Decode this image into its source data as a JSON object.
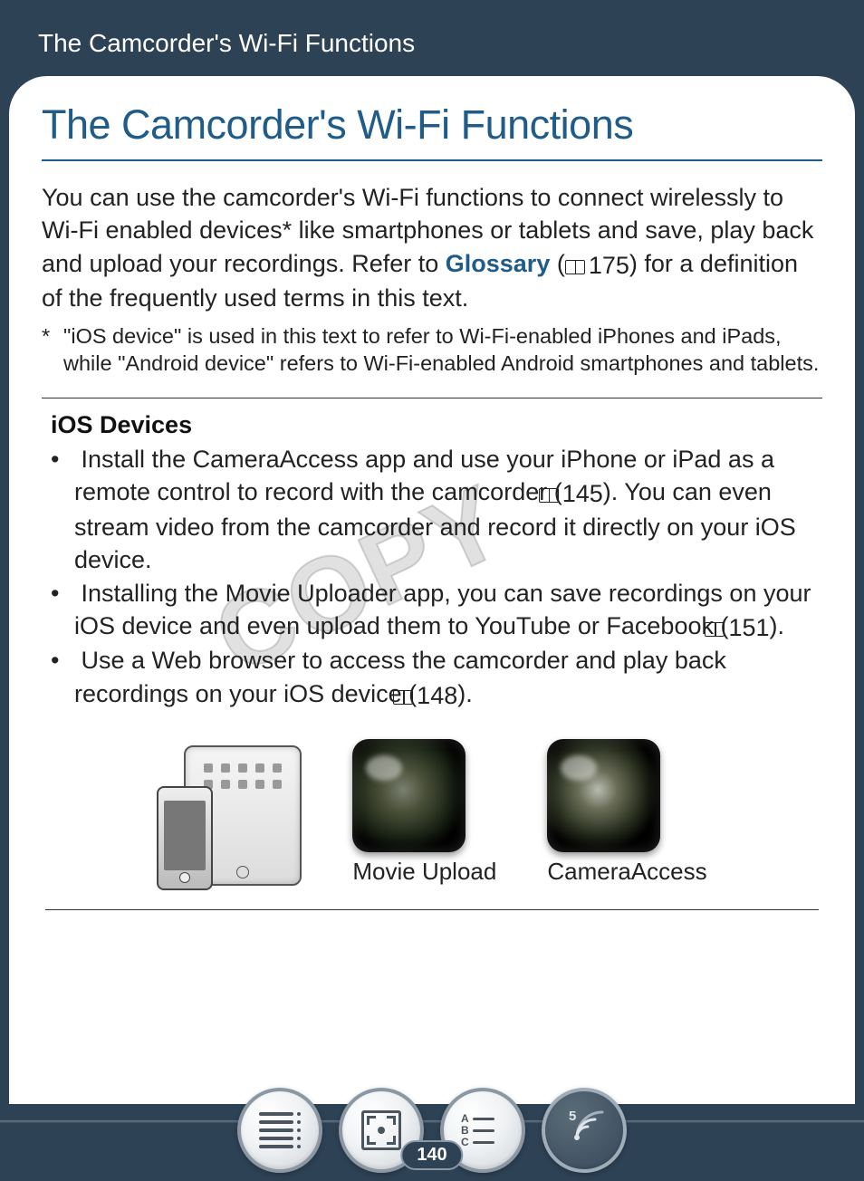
{
  "header": "The Camcorder's Wi-Fi Functions",
  "title": "The Camcorder's Wi-Fi Functions",
  "intro": {
    "part1": "You can use the camcorder's Wi-Fi functions to connect wire­lessly to Wi-Fi enabled devices* like smartphones or tablets and save, play back and upload your recordings. Refer to ",
    "link": "Glossary",
    "part2_a": " (",
    "ref1": "175",
    "part2_b": ") for a definition of the frequently used terms in this text."
  },
  "footnote": "\"iOS device\" is used in this text to refer to Wi-Fi-enabled iPhones and iPads, while \"Android device\" refers to Wi-Fi-enabled Android smart­phones and tablets.",
  "subsection": {
    "heading": "iOS Devices",
    "items": [
      {
        "pre": "Install the CameraAccess app and use your iPhone or iPad as a remote control to record with the camcorder (",
        "ref": "145",
        "post": "). You can even stream video from the camcorder and record it directly on your iOS device."
      },
      {
        "pre": "Installing the Movie Uploader app, you can save recordings on your iOS device and even upload them to YouTube or Facebook (",
        "ref": "151",
        "post": ")."
      },
      {
        "pre": "Use a Web browser to access the camcorder and play back recordings on your iOS device (",
        "ref": "148",
        "post": ")."
      }
    ]
  },
  "thumbs": {
    "movie_upload": "Movie Upload",
    "camera_access": "CameraAccess"
  },
  "watermark": "COPY",
  "nav": {
    "page_number": "140",
    "wifi_badge": "5"
  }
}
